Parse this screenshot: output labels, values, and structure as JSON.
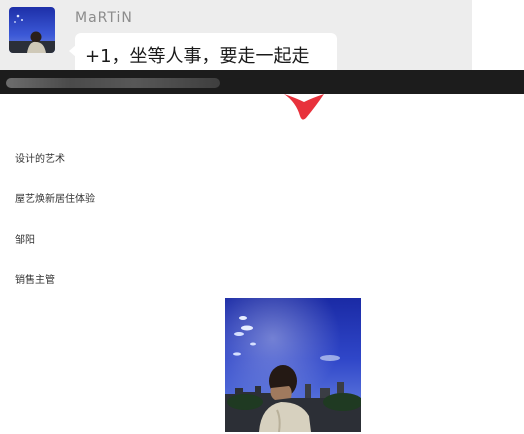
{
  "chat": {
    "sender_name": "MaRTiN",
    "message": "+1，坐等人事，要走一起走"
  },
  "profile": {
    "items": [
      {
        "label": "设计的艺术"
      },
      {
        "label": "屋艺焕新居住体验"
      },
      {
        "label": "邹阳"
      },
      {
        "label": "销售主管"
      }
    ]
  },
  "colors": {
    "chat_background": "#ededed",
    "bubble": "#ffffff",
    "dark_bar": "#1c1c1c",
    "accent_red": "#e8323c",
    "sky_blue": "#2f46c8"
  },
  "icons": {
    "avatar": "avatar-photo",
    "photo": "profile-photo"
  }
}
